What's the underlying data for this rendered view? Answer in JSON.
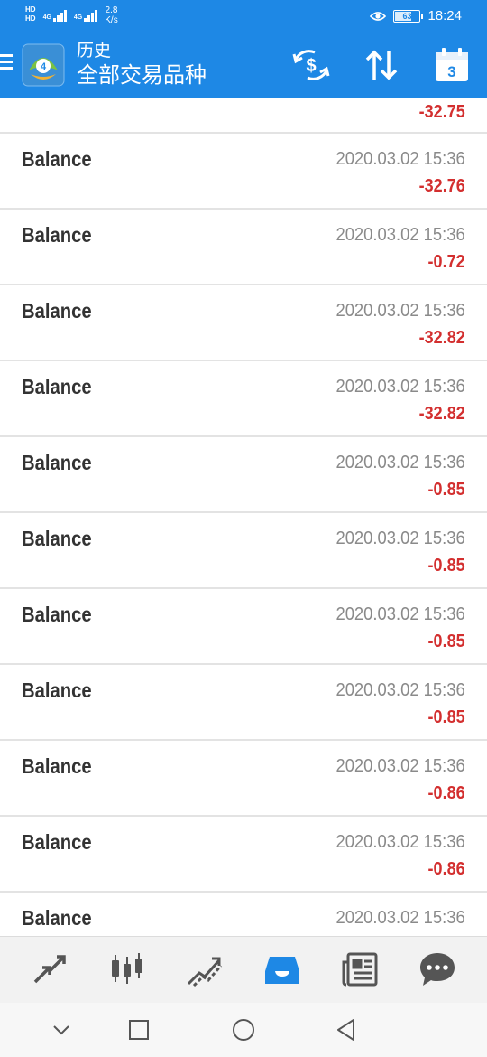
{
  "status_bar": {
    "sim1": "HD",
    "sim2": "HD",
    "net1": "4G",
    "net2": "4G",
    "speed_value": "2.8",
    "speed_unit": "K/s",
    "battery": "63",
    "battery_level": 0.63,
    "time": "18:24"
  },
  "app_bar": {
    "subtitle": "历史",
    "title": "全部交易品种",
    "calendar_day": "3"
  },
  "history": {
    "first_partial": {
      "amount": "-32.75"
    },
    "rows": [
      {
        "name": "Balance",
        "time": "2020.03.02 15:36",
        "amount": "-32.76"
      },
      {
        "name": "Balance",
        "time": "2020.03.02 15:36",
        "amount": "-0.72"
      },
      {
        "name": "Balance",
        "time": "2020.03.02 15:36",
        "amount": "-32.82"
      },
      {
        "name": "Balance",
        "time": "2020.03.02 15:36",
        "amount": "-32.82"
      },
      {
        "name": "Balance",
        "time": "2020.03.02 15:36",
        "amount": "-0.85"
      },
      {
        "name": "Balance",
        "time": "2020.03.02 15:36",
        "amount": "-0.85"
      },
      {
        "name": "Balance",
        "time": "2020.03.02 15:36",
        "amount": "-0.85"
      },
      {
        "name": "Balance",
        "time": "2020.03.02 15:36",
        "amount": "-0.85"
      },
      {
        "name": "Balance",
        "time": "2020.03.02 15:36",
        "amount": "-0.86"
      },
      {
        "name": "Balance",
        "time": "2020.03.02 15:36",
        "amount": "-0.86"
      },
      {
        "name": "Balance",
        "time": "2020.03.02 15:36",
        "amount": ""
      }
    ]
  },
  "tab_bar": {
    "tabs": [
      {
        "icon": "quotes-icon",
        "active": false
      },
      {
        "icon": "chart-icon",
        "active": false
      },
      {
        "icon": "trade-icon",
        "active": false
      },
      {
        "icon": "history-icon",
        "active": true
      },
      {
        "icon": "news-icon",
        "active": false
      },
      {
        "icon": "chat-icon",
        "active": false
      }
    ]
  },
  "colors": {
    "primary": "#1e88e5",
    "negative": "#d32f2f",
    "tab_icon": "#555555",
    "tab_active": "#1e88e5"
  }
}
